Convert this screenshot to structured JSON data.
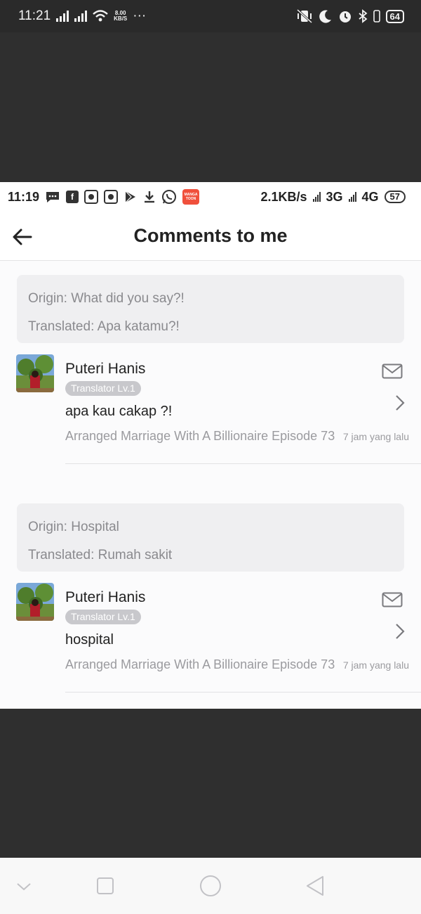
{
  "outer_status": {
    "time": "11:21",
    "speed_value": "8.00",
    "speed_unit": "KB/S",
    "dots": "···",
    "battery": "64"
  },
  "inner_status": {
    "time": "11:19",
    "fb": "f",
    "manga_text": "MANGA TOON",
    "speed": "2.1KB/s",
    "net1": "3G",
    "net2": "4G",
    "battery": "57"
  },
  "header": {
    "title": "Comments to me"
  },
  "comments": [
    {
      "origin": "Origin: What did you say?!",
      "translated": "Translated: Apa katamu?!",
      "user": "Puteri Hanis",
      "badge": "Translator Lv.1",
      "text": "apa kau cakap ?!",
      "meta": "Arranged Marriage With A Billionaire   Episode 73",
      "time": "7 jam yang lalu"
    },
    {
      "origin": "Origin: Hospital",
      "translated": "Translated: Rumah sakit",
      "user": "Puteri Hanis",
      "badge": "Translator Lv.1",
      "text": "hospital",
      "meta": "Arranged Marriage With A Billionaire   Episode 73",
      "time": "7 jam yang lalu"
    }
  ],
  "colors": {
    "background_dim": "#2f2f2f",
    "quote_bg": "#efeff1",
    "badge_bg": "#c8c8cc",
    "manga_red": "#f0503c"
  },
  "icons": [
    "back-arrow-icon",
    "mail-icon",
    "chevron-right-icon",
    "nav-back-icon",
    "nav-home-icon",
    "nav-recents-icon",
    "nav-down-icon"
  ]
}
